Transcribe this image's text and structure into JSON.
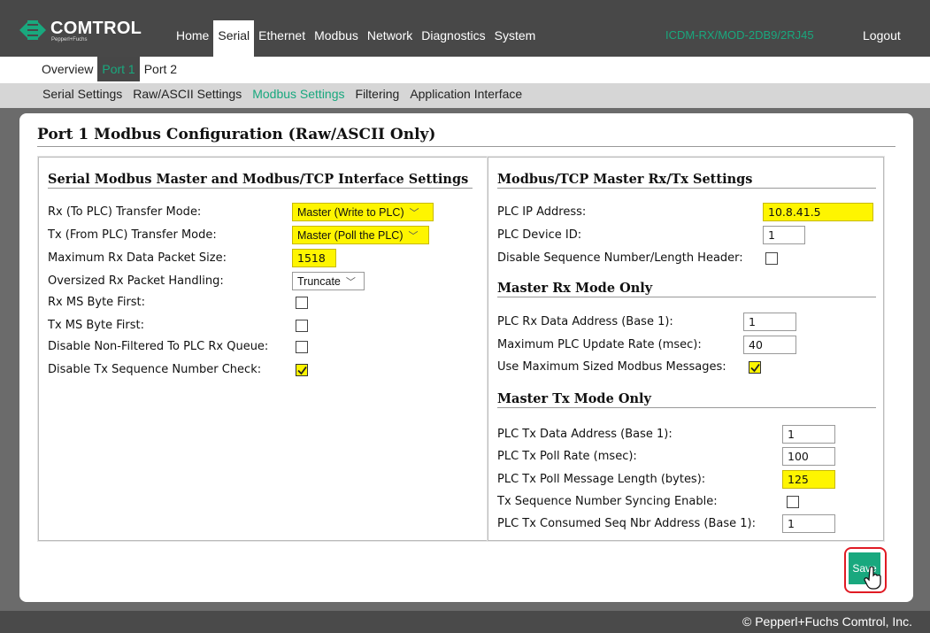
{
  "brand": {
    "name": "COMTROL",
    "sub": "Pepperl+Fuchs",
    "accent": "#19a87e",
    "highlight": "#fef500"
  },
  "topnav": {
    "items": [
      {
        "label": "Home"
      },
      {
        "label": "Serial"
      },
      {
        "label": "Ethernet"
      },
      {
        "label": "Modbus"
      },
      {
        "label": "Network"
      },
      {
        "label": "Diagnostics"
      },
      {
        "label": "System"
      }
    ],
    "active": "Serial",
    "device": "ICDM-RX/MOD-2DB9/2RJ45",
    "logout": "Logout"
  },
  "subnav1": {
    "items": [
      {
        "label": "Overview"
      },
      {
        "label": "Port 1"
      },
      {
        "label": "Port 2"
      }
    ],
    "active": "Port 1"
  },
  "subnav2": {
    "items": [
      {
        "label": "Serial Settings"
      },
      {
        "label": "Raw/ASCII Settings"
      },
      {
        "label": "Modbus Settings"
      },
      {
        "label": "Filtering"
      },
      {
        "label": "Application Interface"
      }
    ],
    "active": "Modbus Settings"
  },
  "page": {
    "title": "Port 1 Modbus Configuration (Raw/ASCII Only)"
  },
  "left": {
    "heading": "Serial Modbus Master and Modbus/TCP Interface Settings",
    "rx_mode": {
      "label": "Rx (To PLC) Transfer Mode:",
      "value": "Master (Write to PLC)"
    },
    "tx_mode": {
      "label": "Tx (From PLC) Transfer Mode:",
      "value": "Master (Poll the PLC)"
    },
    "max_rx": {
      "label": "Maximum Rx Data Packet Size:",
      "value": "1518"
    },
    "oversized": {
      "label": "Oversized Rx Packet Handling:",
      "value": "Truncate"
    },
    "rx_ms": {
      "label": "Rx MS Byte First:",
      "checked": false
    },
    "tx_ms": {
      "label": "Tx MS Byte First:",
      "checked": false
    },
    "disable_nf": {
      "label": "Disable Non-Filtered To PLC Rx Queue:",
      "checked": false
    },
    "disable_tx_seq": {
      "label": "Disable Tx Sequence Number Check:",
      "checked": true
    }
  },
  "right": {
    "heading": "Modbus/TCP Master Rx/Tx Settings",
    "plc_ip": {
      "label": "PLC IP Address:",
      "value": "10.8.41.5"
    },
    "plc_dev": {
      "label": "PLC Device ID:",
      "value": "1"
    },
    "disable_seq": {
      "label": "Disable Sequence Number/Length Header:",
      "checked": false
    },
    "rx_heading": "Master Rx Mode Only",
    "rx_addr": {
      "label": "PLC Rx Data Address (Base 1):",
      "value": "1"
    },
    "max_rate": {
      "label": "Maximum PLC Update Rate (msec):",
      "value": "40"
    },
    "use_max": {
      "label": "Use Maximum Sized Modbus Messages:",
      "checked": true
    },
    "tx_heading": "Master Tx Mode Only",
    "tx_addr": {
      "label": "PLC Tx Data Address (Base 1):",
      "value": "1"
    },
    "tx_poll": {
      "label": "PLC Tx Poll Rate (msec):",
      "value": "100"
    },
    "tx_len": {
      "label": "PLC Tx Poll Message Length (bytes):",
      "value": "125"
    },
    "tx_sync": {
      "label": "Tx Sequence Number Syncing Enable:",
      "checked": false
    },
    "tx_consumed": {
      "label": "PLC Tx Consumed Seq Nbr Address (Base 1):",
      "value": "1"
    }
  },
  "save": {
    "label": "Save"
  },
  "footer": {
    "text": "© Pepperl+Fuchs Comtrol, Inc."
  }
}
